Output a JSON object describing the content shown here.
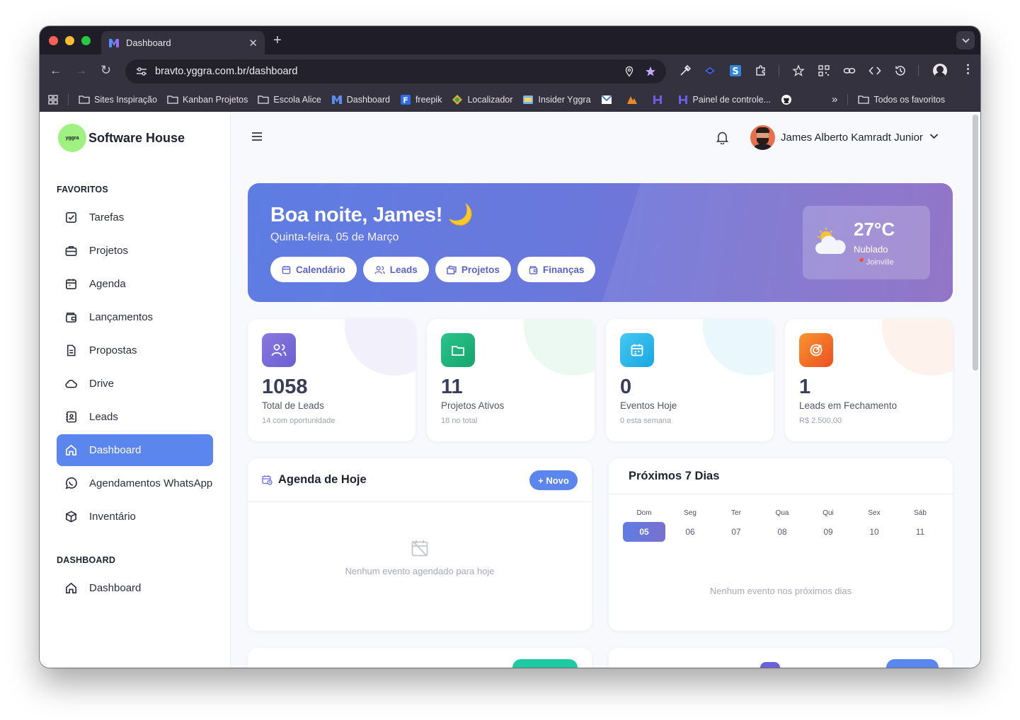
{
  "browser": {
    "tab_title": "Dashboard",
    "url": "bravto.yggra.com.br/dashboard",
    "bookmarks": [
      "Sites Inspiração",
      "Kanban Projetos",
      "Escola Alice",
      "Dashboard",
      "freepik",
      "Localizador",
      "Insider Yggra",
      "Painel de controle..."
    ],
    "more_bookmarks": "»",
    "all_bookmarks": "Todos os favoritos"
  },
  "sidebar": {
    "brand": "Software House",
    "logo_text": "yggra",
    "sections": {
      "favorites": "FAVORITOS",
      "dashboard": "DASHBOARD"
    },
    "items": [
      {
        "label": "Tarefas",
        "icon": "checkbox-icon"
      },
      {
        "label": "Projetos",
        "icon": "briefcase-icon"
      },
      {
        "label": "Agenda",
        "icon": "calendar-icon"
      },
      {
        "label": "Lançamentos",
        "icon": "wallet-icon"
      },
      {
        "label": "Propostas",
        "icon": "document-icon"
      },
      {
        "label": "Drive",
        "icon": "cloud-icon"
      },
      {
        "label": "Leads",
        "icon": "contacts-icon"
      },
      {
        "label": "Dashboard",
        "icon": "home-icon"
      },
      {
        "label": "Agendamentos WhatsApp",
        "icon": "whatsapp-icon"
      },
      {
        "label": "Inventário",
        "icon": "box-icon"
      }
    ],
    "dashboard_items": [
      {
        "label": "Dashboard",
        "icon": "home-icon"
      }
    ]
  },
  "header": {
    "user_name": "James Alberto Kamradt Junior"
  },
  "hero": {
    "greeting": "Boa noite, James! 🌙",
    "date": "Quinta-feira, 05 de Março",
    "buttons": [
      "Calendário",
      "Leads",
      "Projetos",
      "Finanças"
    ],
    "weather": {
      "temp": "27°C",
      "condition": "Nublado",
      "city": "Joinville"
    }
  },
  "stats": [
    {
      "value": "1058",
      "label": "Total de Leads",
      "sub": "14 com oportunidade",
      "color": "#7c6bd6"
    },
    {
      "value": "11",
      "label": "Projetos Ativos",
      "sub": "18 no total",
      "color": "#1fb47f"
    },
    {
      "value": "0",
      "label": "Eventos Hoje",
      "sub": "0 esta semana",
      "color": "#2fb8ea"
    },
    {
      "value": "1",
      "label": "Leads em Fechamento",
      "sub": "R$ 2.500,00",
      "color": "#f0692a"
    }
  ],
  "agenda": {
    "title": "Agenda de Hoje",
    "new_button": "+ Novo",
    "empty": "Nenhum evento agendado para hoje"
  },
  "next7": {
    "title": "Próximos 7 Dias",
    "days": [
      {
        "name": "Dom",
        "num": "05"
      },
      {
        "name": "Seg",
        "num": "06"
      },
      {
        "name": "Ter",
        "num": "07"
      },
      {
        "name": "Qua",
        "num": "08"
      },
      {
        "name": "Qui",
        "num": "09"
      },
      {
        "name": "Sex",
        "num": "10"
      },
      {
        "name": "Sáb",
        "num": "11"
      }
    ],
    "empty": "Nenhum evento nos próximos dias"
  },
  "colors": {
    "accent": "#5b86ee",
    "hero_start": "#5e7de3",
    "hero_end": "#8a6ac2"
  }
}
